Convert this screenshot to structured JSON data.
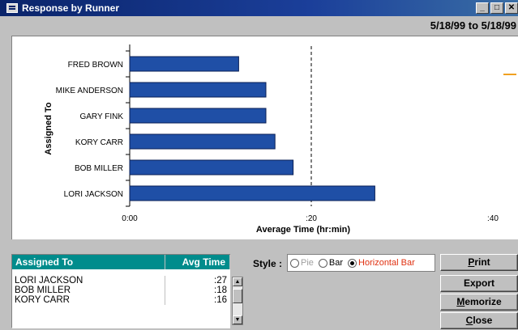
{
  "window": {
    "title": "Response by Runner",
    "icon": "form-icon",
    "controls": [
      "_",
      "□",
      "X"
    ]
  },
  "date_range": "5/18/99 to 5/18/99",
  "chart_data": {
    "type": "bar",
    "orientation": "horizontal",
    "ylabel": "Assigned To",
    "xlabel": "Average Time (hr:min)",
    "categories": [
      "FRED BROWN",
      "MIKE ANDERSON",
      "GARY FINK",
      "KORY CARR",
      "BOB MILLER",
      "LORI JACKSON"
    ],
    "values": [
      12,
      15,
      15,
      16,
      18,
      27
    ],
    "value_unit": "minutes",
    "xlim": [
      0,
      40
    ],
    "x_ticks": [
      {
        "value": 0,
        "label": "0:00"
      },
      {
        "value": 20,
        "label": ":20"
      },
      {
        "value": 40,
        "label": ":40"
      }
    ],
    "reference_line": {
      "value": 20,
      "style": "dashed"
    },
    "bar_color": "#1f4fa6",
    "legend": "none"
  },
  "grid": {
    "headers": {
      "name": "Assigned To",
      "avg": "Avg Time"
    },
    "rows": [
      {
        "name": "LORI JACKSON",
        "avg": ":27"
      },
      {
        "name": "BOB MILLER",
        "avg": ":18"
      },
      {
        "name": "KORY CARR",
        "avg": ":16"
      }
    ]
  },
  "style": {
    "label": "Style :",
    "options": [
      {
        "label": "Pie",
        "selected": false,
        "enabled": false
      },
      {
        "label": "Bar",
        "selected": false,
        "enabled": true
      },
      {
        "label": "Horizontal Bar",
        "selected": true,
        "enabled": true
      }
    ]
  },
  "buttons": {
    "print": {
      "label": "Print",
      "accel": "P",
      "rest": "rint"
    },
    "export": {
      "label": "Export"
    },
    "memorize": {
      "label": "Memorize",
      "accel": "M",
      "rest": "emorize"
    },
    "close": {
      "label": "Close",
      "accel": "C",
      "rest": "lose"
    }
  },
  "colors": {
    "titlebar": "#0a246a",
    "grid_header": "#008c8c",
    "bars": "#1f4fa6",
    "selected_style": "#e03010"
  }
}
